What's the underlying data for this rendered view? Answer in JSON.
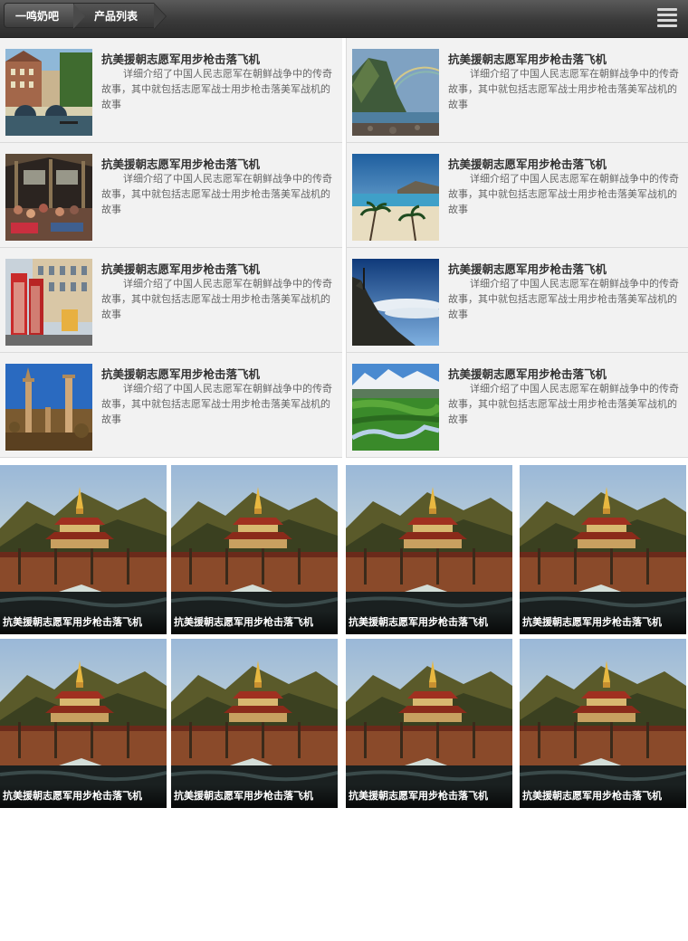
{
  "header": {
    "home_label": "一鸣奶吧",
    "list_label": "产品列表",
    "menu_icon": "menu-icon"
  },
  "products": [
    {
      "title": "抗美援朝志愿军用步枪击落飞机",
      "desc": "详细介绍了中国人民志愿军在朝鲜战争中的传奇故事，其中就包括志愿军战士用步枪击落美军战机的故事",
      "image": "city-canal"
    },
    {
      "title": "抗美援朝志愿军用步枪击落飞机",
      "desc": "详细介绍了中国人民志愿军在朝鲜战争中的传奇故事，其中就包括志愿军战士用步枪击落美军战机的故事",
      "image": "rainbow-cliff"
    },
    {
      "title": "抗美援朝志愿军用步枪击落飞机",
      "desc": "详细介绍了中国人民志愿军在朝鲜战争中的传奇故事，其中就包括志愿军战士用步枪击落美军战机的故事",
      "image": "market-hall"
    },
    {
      "title": "抗美援朝志愿军用步枪击落飞机",
      "desc": "详细介绍了中国人民志愿军在朝鲜战争中的传奇故事，其中就包括志愿军战士用步枪击落美军战机的故事",
      "image": "palm-beach"
    },
    {
      "title": "抗美援朝志愿军用步枪击落飞机",
      "desc": "详细介绍了中国人民志愿军在朝鲜战争中的传奇故事，其中就包括志愿军战士用步枪击落美军战机的故事",
      "image": "phone-booth"
    },
    {
      "title": "抗美援朝志愿军用步枪击落飞机",
      "desc": "详细介绍了中国人民志愿军在朝鲜战争中的传奇故事，其中就包括志愿军战士用步枪击落美军战机的故事",
      "image": "mountain-clouds"
    },
    {
      "title": "抗美援朝志愿军用步枪击落飞机",
      "desc": "详细介绍了中国人民志愿军在朝鲜战争中的传奇故事，其中就包括志愿军战士用步枪击落美军战机的故事",
      "image": "ancient-ruins"
    },
    {
      "title": "抗美援朝志愿军用步枪击落飞机",
      "desc": "详细介绍了中国人民志愿军在朝鲜战争中的传奇故事，其中就包括志愿军战士用步枪击落美军战机的故事",
      "image": "green-valley"
    }
  ],
  "gallery": [
    {
      "caption": "抗美援朝志愿军用步枪击落飞机",
      "image": "pagoda-bridge"
    },
    {
      "caption": "抗美援朝志愿军用步枪击落飞机",
      "image": "pagoda-bridge"
    },
    {
      "caption": "抗美援朝志愿军用步枪击落飞机",
      "image": "pagoda-bridge"
    },
    {
      "caption": "抗美援朝志愿军用步枪击落飞机",
      "image": "pagoda-bridge"
    },
    {
      "caption": "抗美援朝志愿军用步枪击落飞机",
      "image": "pagoda-bridge"
    },
    {
      "caption": "抗美援朝志愿军用步枪击落飞机",
      "image": "pagoda-bridge"
    },
    {
      "caption": "抗美援朝志愿军用步枪击落飞机",
      "image": "pagoda-bridge"
    },
    {
      "caption": "抗美援朝志愿军用步枪击落飞机",
      "image": "pagoda-bridge"
    }
  ]
}
